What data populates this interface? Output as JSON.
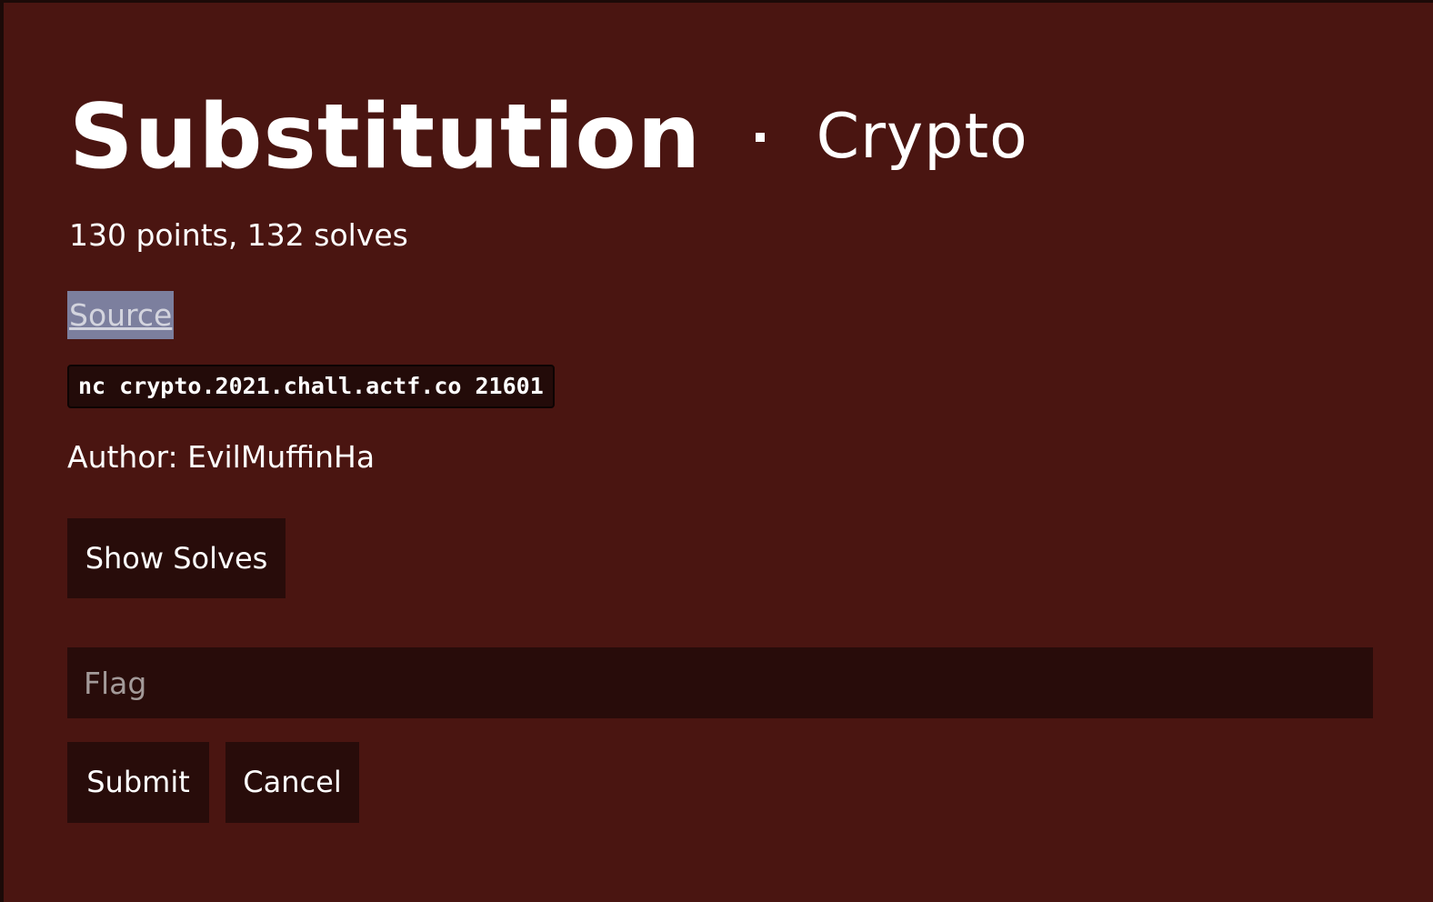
{
  "challenge": {
    "title": "Substitution",
    "category": "Crypto",
    "stats": "130 points, 132 solves",
    "source_link": "Source",
    "connection_command": "nc crypto.2021.chall.actf.co 21601",
    "author": "Author: EvilMuffinHa"
  },
  "actions": {
    "show_solves_label": "Show Solves",
    "flag_placeholder": "Flag",
    "submit_label": "Submit",
    "cancel_label": "Cancel"
  },
  "colors": {
    "modal_background": "#4a1511",
    "button_background": "#280c0a",
    "link_highlight": "#7c7f9e",
    "text": "#ffffff"
  }
}
